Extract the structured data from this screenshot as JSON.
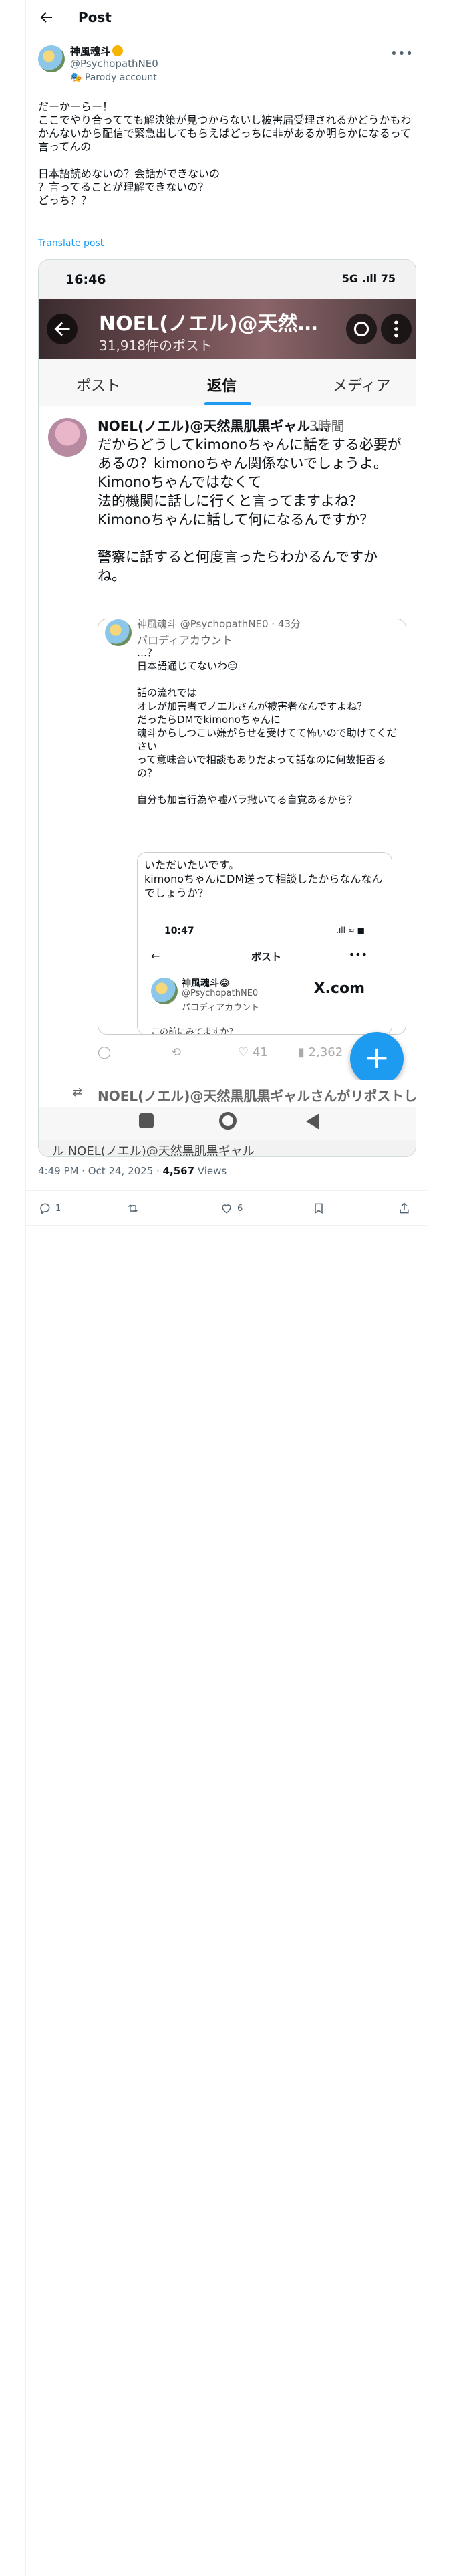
{
  "header": {
    "title": "Post"
  },
  "author": {
    "name": "神風魂斗",
    "handle": "@PsychopathNE0",
    "parody_label": "Parody account"
  },
  "post": {
    "text": "だーかーらー！\nここでやり合ってても解決策が見つからないし被害届受理されるかどうかもわかんないから配信で緊急出してもらえばどっちに非があるか明らかになるって言ってんの\n\n日本語読めないの？会話ができないの\n？言ってることが理解できないの？\nどっち？？",
    "translate_label": "Translate post",
    "timestamp": "4:49 PM · Oct 24, 2025",
    "views_count": "4,567",
    "views_label": "Views"
  },
  "embedded": {
    "status_time": "16:46",
    "status_right": "5G .ıll 75",
    "banner_title": "NOEL(ノエル)@天然…",
    "banner_subtitle": "31,918件のポスト",
    "tabs": [
      {
        "label": "ポスト"
      },
      {
        "label": "返信"
      },
      {
        "label": "メディア"
      }
    ],
    "reply": {
      "name": "NOEL(ノエル)@天然黒肌黒ギャル …",
      "time": "· 3時間",
      "text": "だからどうしてkimonoちゃんに話をする必要があるの？kimonoちゃん関係ないでしょうよ。\nKimonoちゃんではなくて\n法的機関に話しに行くと言ってますよね？\nKimonoちゃんに話して何になるんですか？\n\n警察に話すると何度言ったらわかるんですかね。",
      "quote": {
        "handle": "神風魂斗 @PsychopathNE0 · 43分",
        "parody": "パロディアカウント",
        "text": "…？\n日本語通じてないわ😑\n\n話の流れでは\nオレが加害者でノエルさんが被害者なんですよね？\nだったらDMでkimonoちゃんに\n魂斗からしつこい嫌がらせを受けてて怖いので助けてください\nって意味合いで相談もありだよって話なのに何故拒否るの？\n\n自分も加害行為や嘘バラ撒いてる自覚あるから？",
        "inner_text": "いただいたいです。\nkimonoちゃんにDM送って相談したからなんなんでしょうか？",
        "inner_time": "10:47",
        "inner_status": ".ıll ≈ ■",
        "inner_title": "ポスト",
        "inner_name": "神風魂斗😂",
        "inner_handle": "@PsychopathNE0",
        "inner_parody": "パロディアカウント",
        "inner_brand": "X.com",
        "inner_foot": "この前にみてますか?"
      },
      "stats": {
        "likes": "41",
        "views": "2,362"
      }
    },
    "repost_text": "NOEL(ノエル)@天然黒肌黒ギャルさんがリポストしま",
    "cut_text": "ル NOEL(ノエル)@天然黒肌黒ギャル"
  },
  "actions": {
    "replies": "1",
    "likes": "6"
  },
  "colors": {
    "accent": "#1d9bf0",
    "muted": "#536471"
  }
}
